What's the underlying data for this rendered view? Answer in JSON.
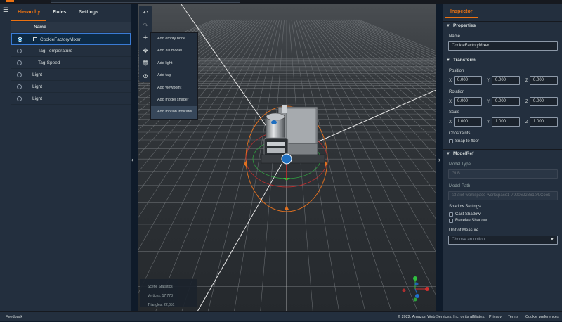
{
  "hierarchy_panel": {
    "tabs": [
      "Hierarchy",
      "Rules",
      "Settings"
    ],
    "column_header": "Name",
    "items": [
      {
        "label": "CookieFactoryMixer",
        "selected": true
      },
      {
        "label": "Tag-Temperature"
      },
      {
        "label": "Tag-Speed"
      },
      {
        "label": "Light"
      },
      {
        "label": "Light"
      },
      {
        "label": "Light"
      }
    ]
  },
  "toolbar": {
    "icons": [
      "undo-icon",
      "redo-icon",
      "add-icon",
      "move-icon",
      "delete-icon",
      "camera-icon"
    ]
  },
  "add_menu": {
    "items": [
      "Add empty node",
      "Add 3D model",
      "Add light",
      "Add tag",
      "Add viewpoint",
      "Add model shader",
      "Add motion indicator"
    ],
    "hover_index": 6
  },
  "scene_statistics": {
    "title": "Scene Statistics",
    "vertices": "Vertices: 17,778",
    "triangles": "Triangles: 22,651"
  },
  "inspector": {
    "tab": "Inspector",
    "properties": {
      "section": "Properties",
      "name_label": "Name",
      "name_value": "CookieFactoryMixer"
    },
    "transform": {
      "section": "Transform",
      "position_label": "Position",
      "position": [
        "0.000",
        "0.000",
        "0.000"
      ],
      "rotation_label": "Rotation",
      "rotation": [
        "0.000",
        "0.000",
        "0.000"
      ],
      "scale_label": "Scale",
      "scale": [
        "1.000",
        "1.000",
        "1.000"
      ],
      "axes": [
        "X",
        "Y",
        "Z"
      ],
      "constraints_label": "Constraints",
      "snap_label": "Snap to floor"
    },
    "modelref": {
      "section": "ModelRef",
      "model_type_label": "Model Type",
      "model_type_value": "GLB",
      "model_path_label": "Model Path",
      "model_path_value": "s3://iot-workspace-workspace1-7900622861e4/Cook",
      "shadow_label": "Shadow Settings",
      "cast_shadow": "Cast Shadow",
      "receive_shadow": "Receive Shadow",
      "unit_label": "Unit of Measure",
      "unit_placeholder": "Choose an option"
    }
  },
  "footer": {
    "feedback": "Feedback",
    "copyright": "© 2022, Amazon Web Services, Inc. or its affiliates.",
    "links": [
      "Privacy",
      "Terms",
      "Cookie preferences"
    ]
  },
  "colors": {
    "accent": "#ec7211",
    "selection": "#0073bb",
    "panel": "#232f3e",
    "viewport": "#2b2f33"
  }
}
